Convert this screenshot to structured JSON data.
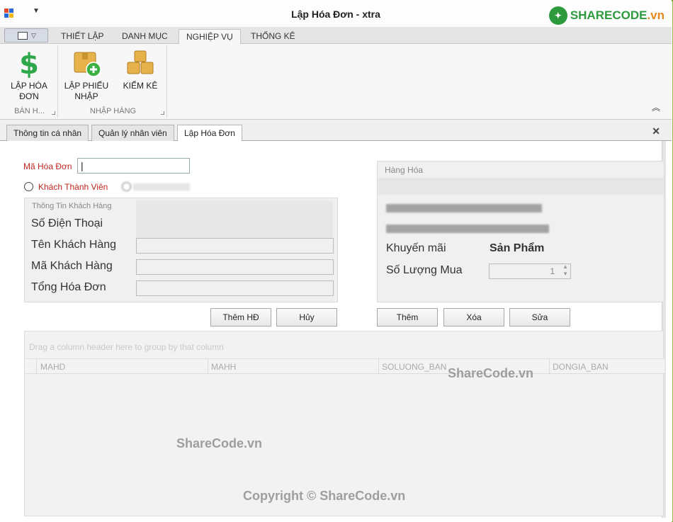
{
  "window": {
    "title": "Lập Hóa Đơn - xtra"
  },
  "logo": {
    "text_main": "SHARECODE",
    "text_suffix": ".vn"
  },
  "ribbon_tabs": [
    "THIẾT LẬP",
    "DANH MỤC",
    "NGHIỆP VỤ",
    "THỐNG KÊ"
  ],
  "ribbon": {
    "groups": [
      {
        "label": "BÁN H...",
        "buttons": [
          {
            "line1": "LẬP HÓA",
            "line2": "ĐƠN",
            "icon": "dollar-icon"
          }
        ]
      },
      {
        "label": "NHẬP HÀNG",
        "buttons": [
          {
            "line1": "LẬP PHIẾU",
            "line2": "NHẬP",
            "icon": "box-add-icon"
          },
          {
            "line1": "KIỂM KÊ",
            "line2": "",
            "icon": "boxes-icon"
          }
        ]
      }
    ]
  },
  "doc_tabs": [
    "Thông tin cá nhân",
    "Quản lý nhân viên",
    "Lập Hóa Đơn"
  ],
  "form": {
    "invoice_label": "Mã Hóa Đơn",
    "invoice_value": "|",
    "radio_member": "Khách Thành Viên",
    "customer_panel_title": "Thông Tin Khách Hàng",
    "fields": [
      "Số Điện Thoại",
      "Tên Khách Hàng",
      "Mã Khách Hàng",
      "Tổng Hóa Đơn"
    ],
    "btn_add_invoice": "Thêm HĐ",
    "btn_cancel": "Hủy"
  },
  "goods": {
    "panel_title": "Hàng Hóa",
    "promo_label": "Khuyến mãi",
    "product_label": "Sản Phẩm",
    "qty_label": "Số Lượng Mua",
    "qty_value": "1",
    "btn_add": "Thêm",
    "btn_delete": "Xóa",
    "btn_edit": "Sửa"
  },
  "grid": {
    "group_hint": "Drag a column header here to group by that column",
    "columns": [
      "MAHD",
      "MAHH",
      "SOLUONG_BAN",
      "DONGIA_BAN"
    ]
  },
  "watermarks": {
    "w1": "ShareCode.vn",
    "w2": "ShareCode.vn",
    "copyright": "Copyright © ShareCode.vn"
  }
}
